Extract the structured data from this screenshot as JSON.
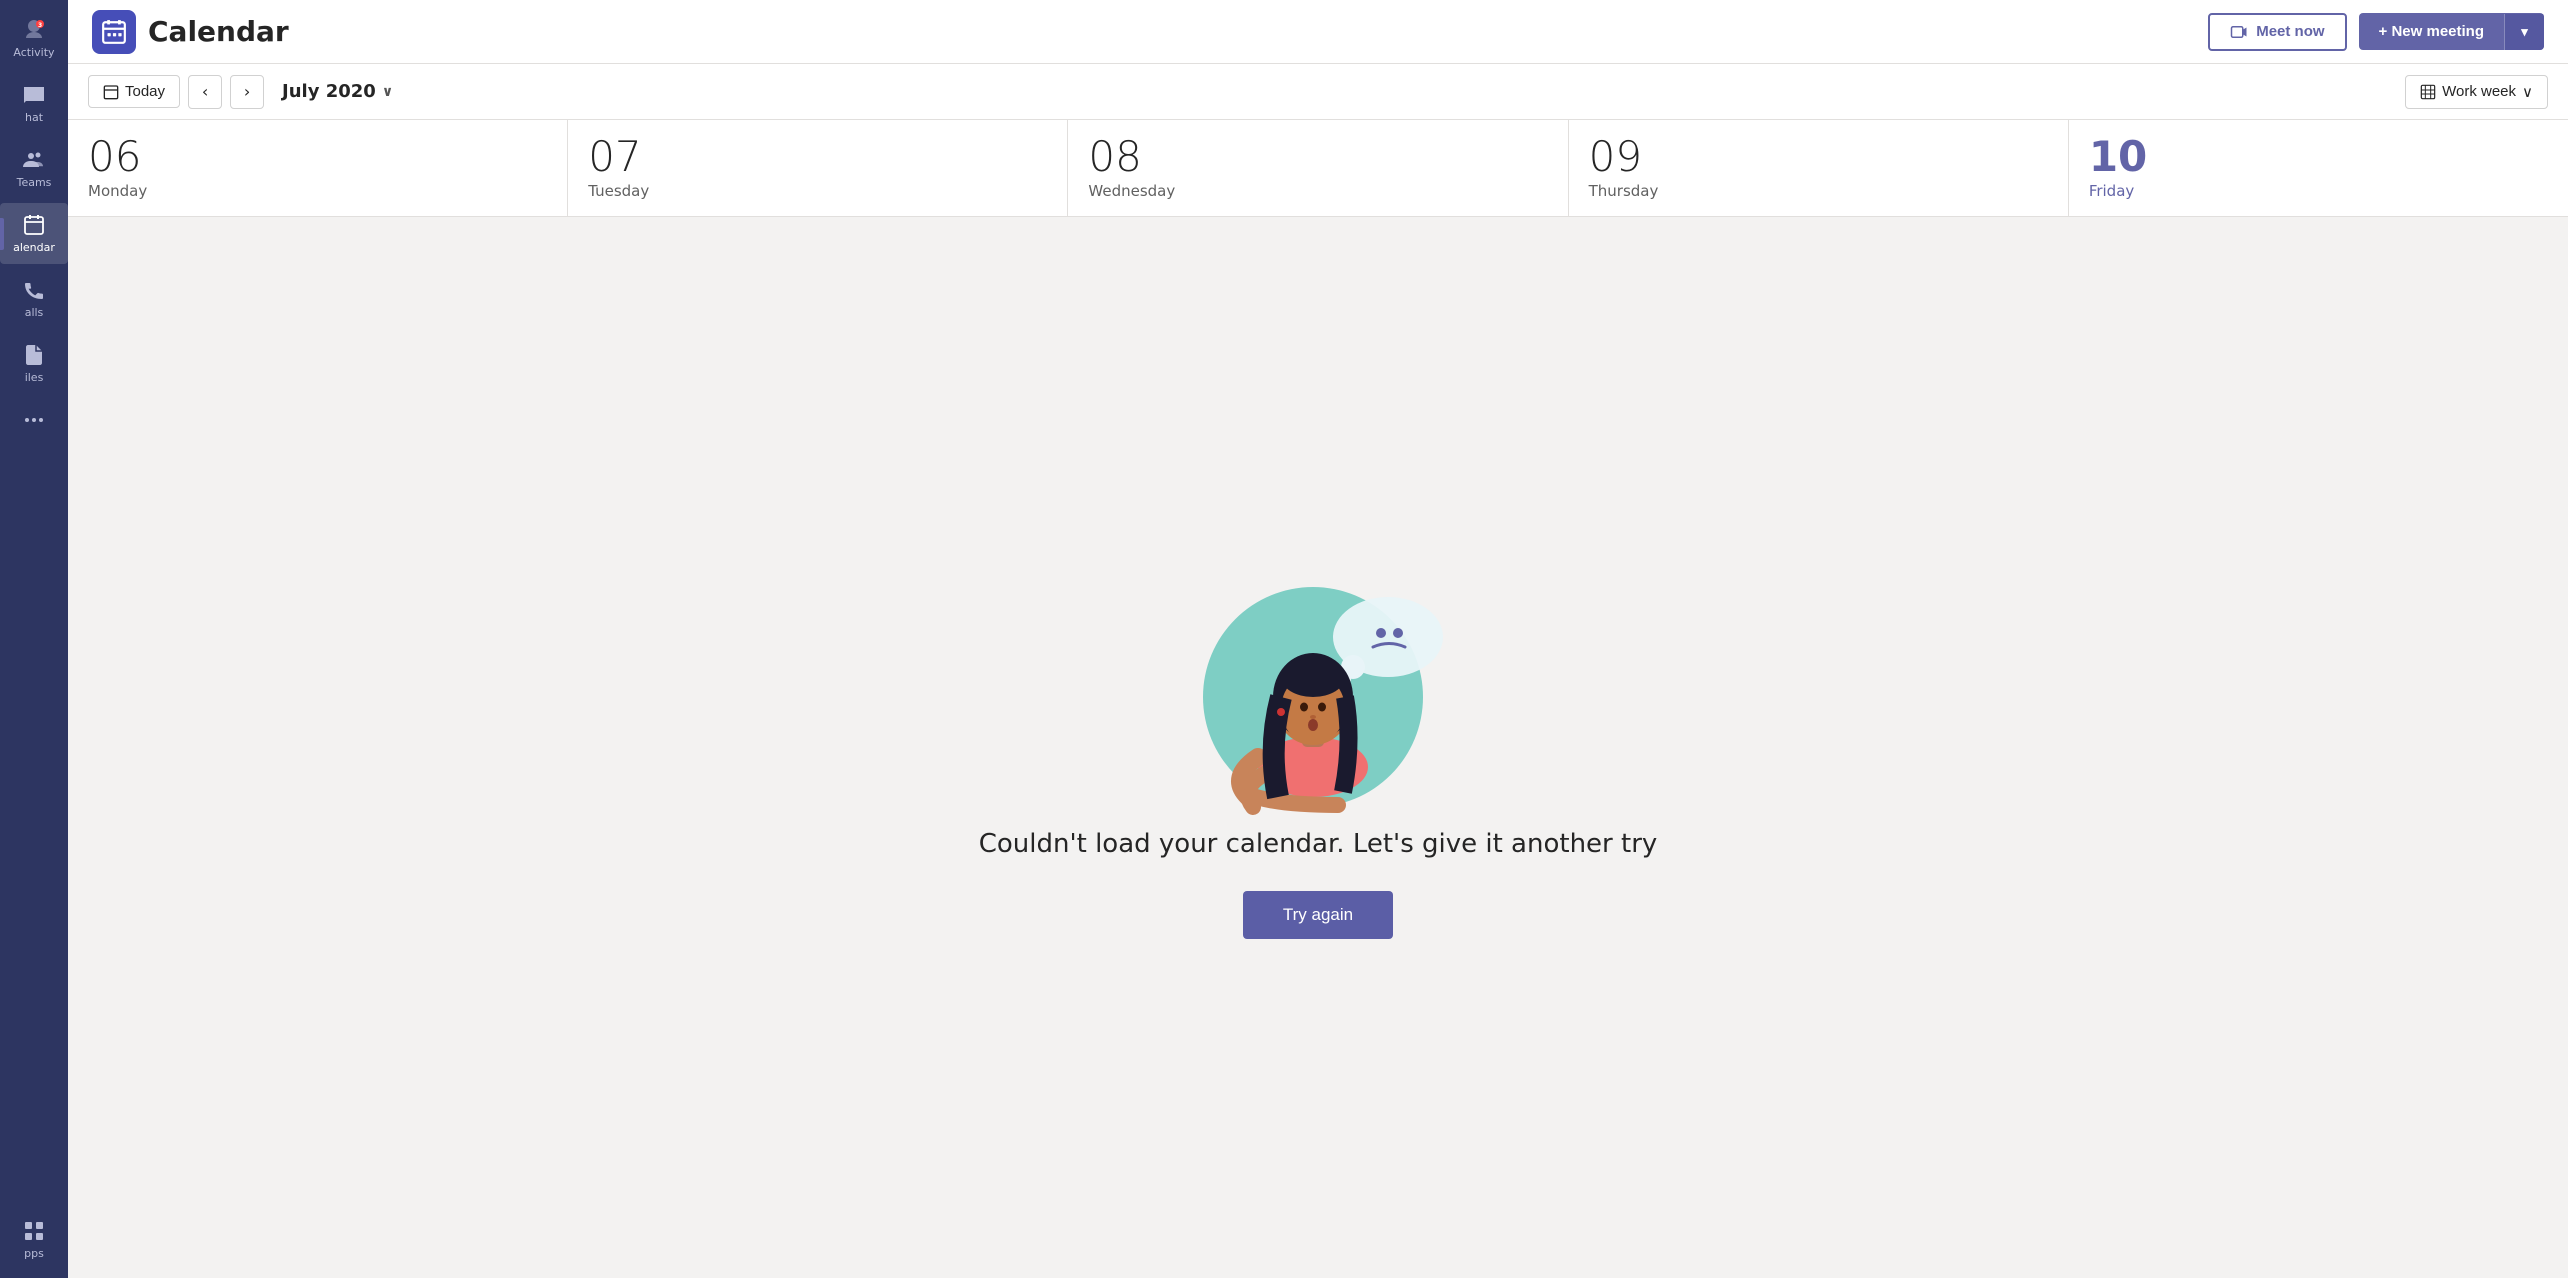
{
  "app": {
    "title": "Calendar"
  },
  "sidebar": {
    "items": [
      {
        "id": "activity",
        "label": "Activity",
        "icon": "activity-icon"
      },
      {
        "id": "chat",
        "label": "hat",
        "icon": "chat-icon"
      },
      {
        "id": "teams",
        "label": "Teams",
        "icon": "teams-icon"
      },
      {
        "id": "calendar",
        "label": "alendar",
        "icon": "calendar-icon",
        "active": true
      },
      {
        "id": "calls",
        "label": "alls",
        "icon": "calls-icon"
      },
      {
        "id": "files",
        "label": "iles",
        "icon": "files-icon"
      },
      {
        "id": "more",
        "label": "",
        "icon": "more-icon"
      }
    ],
    "bottom_items": [
      {
        "id": "apps",
        "label": "pps",
        "icon": "apps-icon"
      }
    ]
  },
  "topbar": {
    "title": "Calendar",
    "meet_now_label": "Meet now",
    "new_meeting_label": "+ New meeting",
    "chevron_label": "▾"
  },
  "navbar": {
    "today_label": "Today",
    "month": "July 2020",
    "chevron": "∨",
    "view_label": "Work week",
    "view_chevron": "∨"
  },
  "calendar": {
    "days": [
      {
        "num": "06",
        "name": "Monday",
        "today": false
      },
      {
        "num": "07",
        "name": "Tuesday",
        "today": false
      },
      {
        "num": "08",
        "name": "Wednesday",
        "today": false
      },
      {
        "num": "09",
        "name": "Thursday",
        "today": false
      },
      {
        "num": "10",
        "name": "Friday",
        "today": true
      }
    ]
  },
  "error": {
    "message": "Couldn't load your calendar. Let's give it another try",
    "try_again_label": "Try again"
  }
}
